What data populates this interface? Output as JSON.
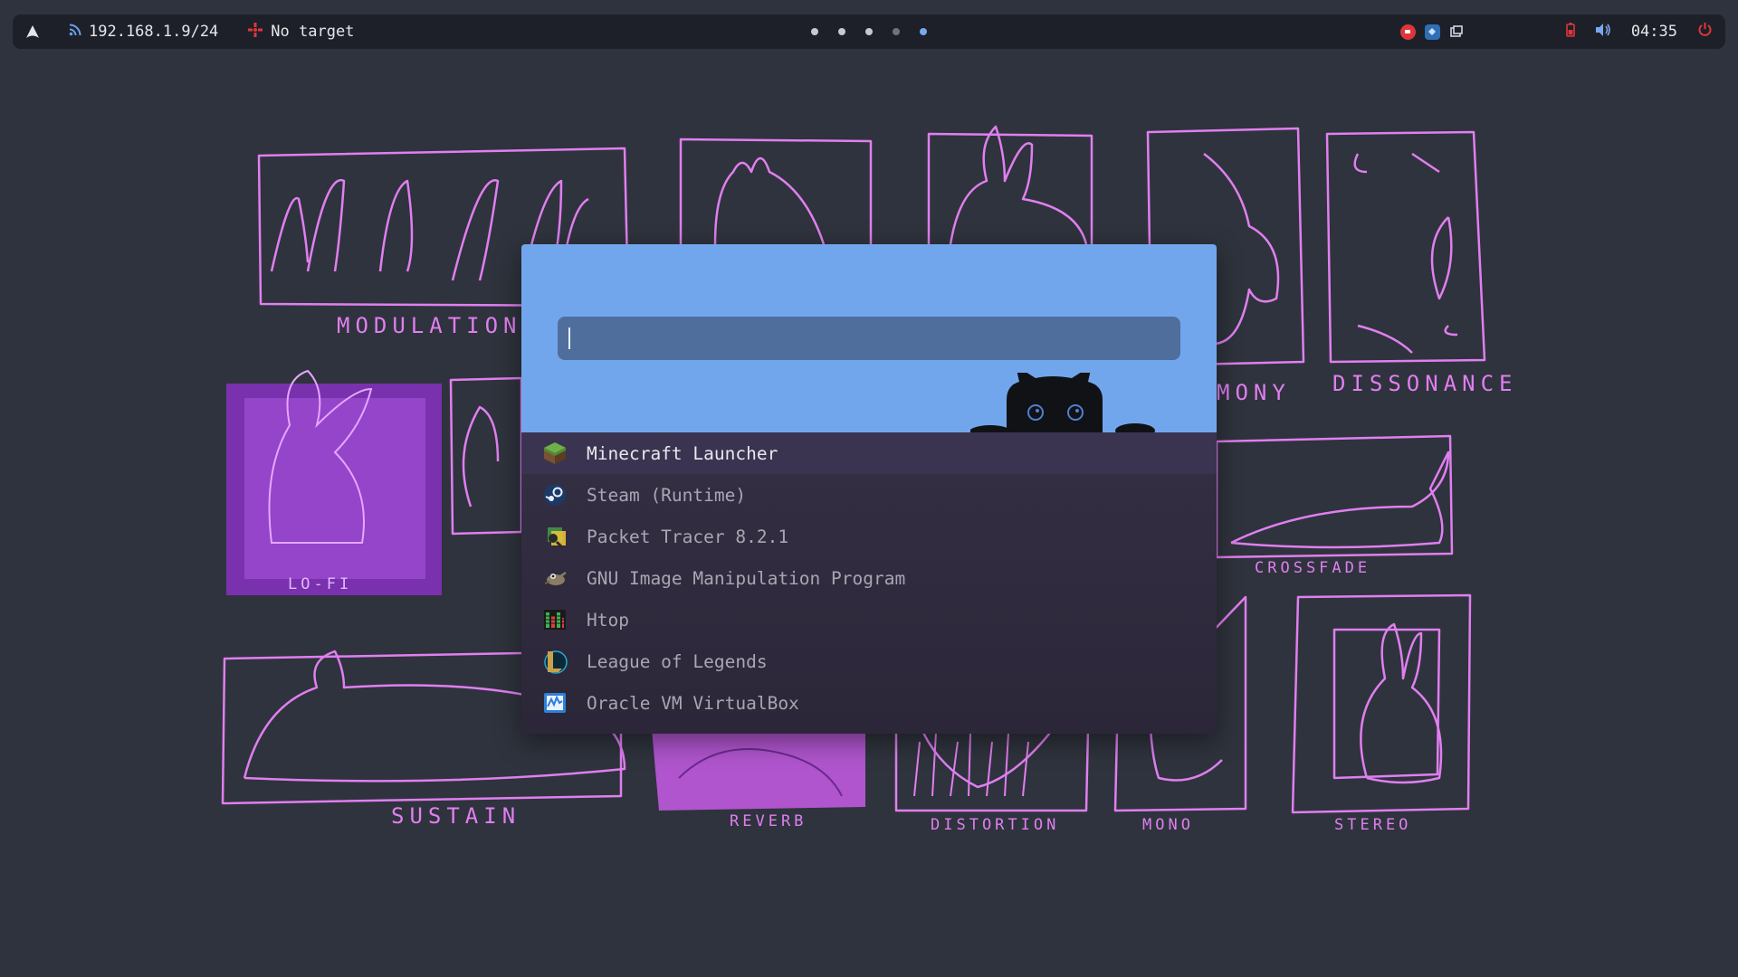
{
  "topbar": {
    "network": "192.168.1.9/24",
    "target": "No target",
    "workspaces": [
      {
        "state": "normal"
      },
      {
        "state": "normal"
      },
      {
        "state": "normal"
      },
      {
        "state": "dim"
      },
      {
        "state": "active"
      }
    ],
    "clock": "04:35",
    "icons": {
      "launcher": "arch-logo-icon",
      "network": "wifi-icon",
      "target": "crosshair-icon",
      "tray": [
        "red-app-icon",
        "blue-app-icon",
        "window-icon"
      ],
      "battery": "battery-icon",
      "volume": "volume-icon",
      "power": "power-icon"
    }
  },
  "wallpaper": {
    "labels": [
      "MODULATION",
      "MONY",
      "DISSONANCE",
      "LO-FI",
      "CROSSFADE",
      "SUSTAIN",
      "REVERB",
      "DISTORTION",
      "MONO",
      "STEREO"
    ],
    "accent": "#e07ff0"
  },
  "launcher": {
    "search": {
      "value": "",
      "placeholder": ""
    },
    "header_color": "#72a6ec",
    "results": [
      {
        "label": "Minecraft Launcher",
        "icon": "minecraft-icon",
        "selected": true
      },
      {
        "label": "Steam (Runtime)",
        "icon": "steam-icon"
      },
      {
        "label": "Packet Tracer 8.2.1",
        "icon": "packet-tracer-icon"
      },
      {
        "label": "GNU Image Manipulation Program",
        "icon": "gimp-icon"
      },
      {
        "label": "Htop",
        "icon": "htop-icon"
      },
      {
        "label": "League of Legends",
        "icon": "league-of-legends-icon"
      },
      {
        "label": "Oracle VM VirtualBox",
        "icon": "virtualbox-icon"
      }
    ]
  }
}
